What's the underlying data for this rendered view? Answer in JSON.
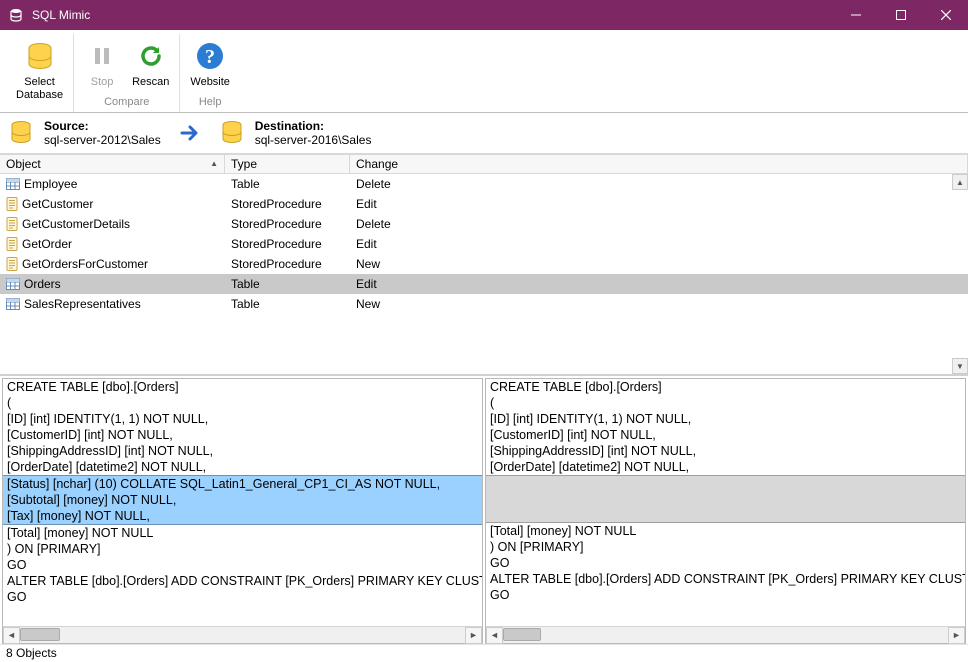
{
  "window": {
    "title": "SQL Mimic"
  },
  "ribbon": {
    "groups": [
      {
        "label": "",
        "buttons": [
          {
            "id": "select-db",
            "label": "Select\nDatabase",
            "enabled": true,
            "icon": "db-yellow"
          }
        ]
      },
      {
        "label": "Compare",
        "buttons": [
          {
            "id": "stop",
            "label": "Stop",
            "enabled": false,
            "icon": "pause"
          },
          {
            "id": "rescan",
            "label": "Rescan",
            "enabled": true,
            "icon": "rescan"
          }
        ]
      },
      {
        "label": "Help",
        "buttons": [
          {
            "id": "website",
            "label": "Website",
            "enabled": true,
            "icon": "help"
          }
        ]
      }
    ]
  },
  "srcdst": {
    "source": {
      "label": "Source:",
      "value": "sql-server-2012\\Sales"
    },
    "destination": {
      "label": "Destination:",
      "value": "sql-server-2016\\Sales"
    }
  },
  "grid": {
    "columns": {
      "object": "Object",
      "type": "Type",
      "change": "Change"
    },
    "rows": [
      {
        "icon": "table",
        "object": "Employee",
        "type": "Table",
        "change": "Delete",
        "selected": false
      },
      {
        "icon": "sproc",
        "object": "GetCustomer",
        "type": "StoredProcedure",
        "change": "Edit",
        "selected": false
      },
      {
        "icon": "sproc",
        "object": "GetCustomerDetails",
        "type": "StoredProcedure",
        "change": "Delete",
        "selected": false
      },
      {
        "icon": "sproc",
        "object": "GetOrder",
        "type": "StoredProcedure",
        "change": "Edit",
        "selected": false
      },
      {
        "icon": "sproc",
        "object": "GetOrdersForCustomer",
        "type": "StoredProcedure",
        "change": "New",
        "selected": false
      },
      {
        "icon": "table",
        "object": "Orders",
        "type": "Table",
        "change": "Edit",
        "selected": true
      },
      {
        "icon": "table",
        "object": "SalesRepresentatives",
        "type": "Table",
        "change": "New",
        "selected": false
      }
    ]
  },
  "diff": {
    "left": {
      "pre": [
        "CREATE TABLE [dbo].[Orders]",
        "(",
        "[ID] [int] IDENTITY(1, 1) NOT NULL,",
        "[CustomerID] [int] NOT NULL,",
        "[ShippingAddressID] [int] NOT NULL,",
        "[OrderDate] [datetime2] NOT NULL,"
      ],
      "hl": [
        "[Status] [nchar] (10) COLLATE SQL_Latin1_General_CP1_CI_AS NOT NULL,",
        "[Subtotal] [money] NOT NULL,",
        "[Tax] [money] NOT NULL,"
      ],
      "post": [
        "[Total] [money] NOT NULL",
        ") ON [PRIMARY]",
        "GO",
        "ALTER TABLE [dbo].[Orders] ADD CONSTRAINT [PK_Orders] PRIMARY KEY CLUSTERED  ([ID",
        "GO"
      ]
    },
    "right": {
      "pre": [
        "CREATE TABLE [dbo].[Orders]",
        "(",
        "[ID] [int] IDENTITY(1, 1) NOT NULL,",
        "[CustomerID] [int] NOT NULL,",
        "[ShippingAddressID] [int] NOT NULL,",
        "[OrderDate] [datetime2] NOT NULL,"
      ],
      "post": [
        "[Total] [money] NOT NULL",
        ") ON [PRIMARY]",
        "GO",
        "ALTER TABLE [dbo].[Orders] ADD CONSTRAINT [PK_Orders] PRIMARY KEY CLUSTERED",
        "GO"
      ]
    }
  },
  "status": {
    "text": "8 Objects"
  }
}
